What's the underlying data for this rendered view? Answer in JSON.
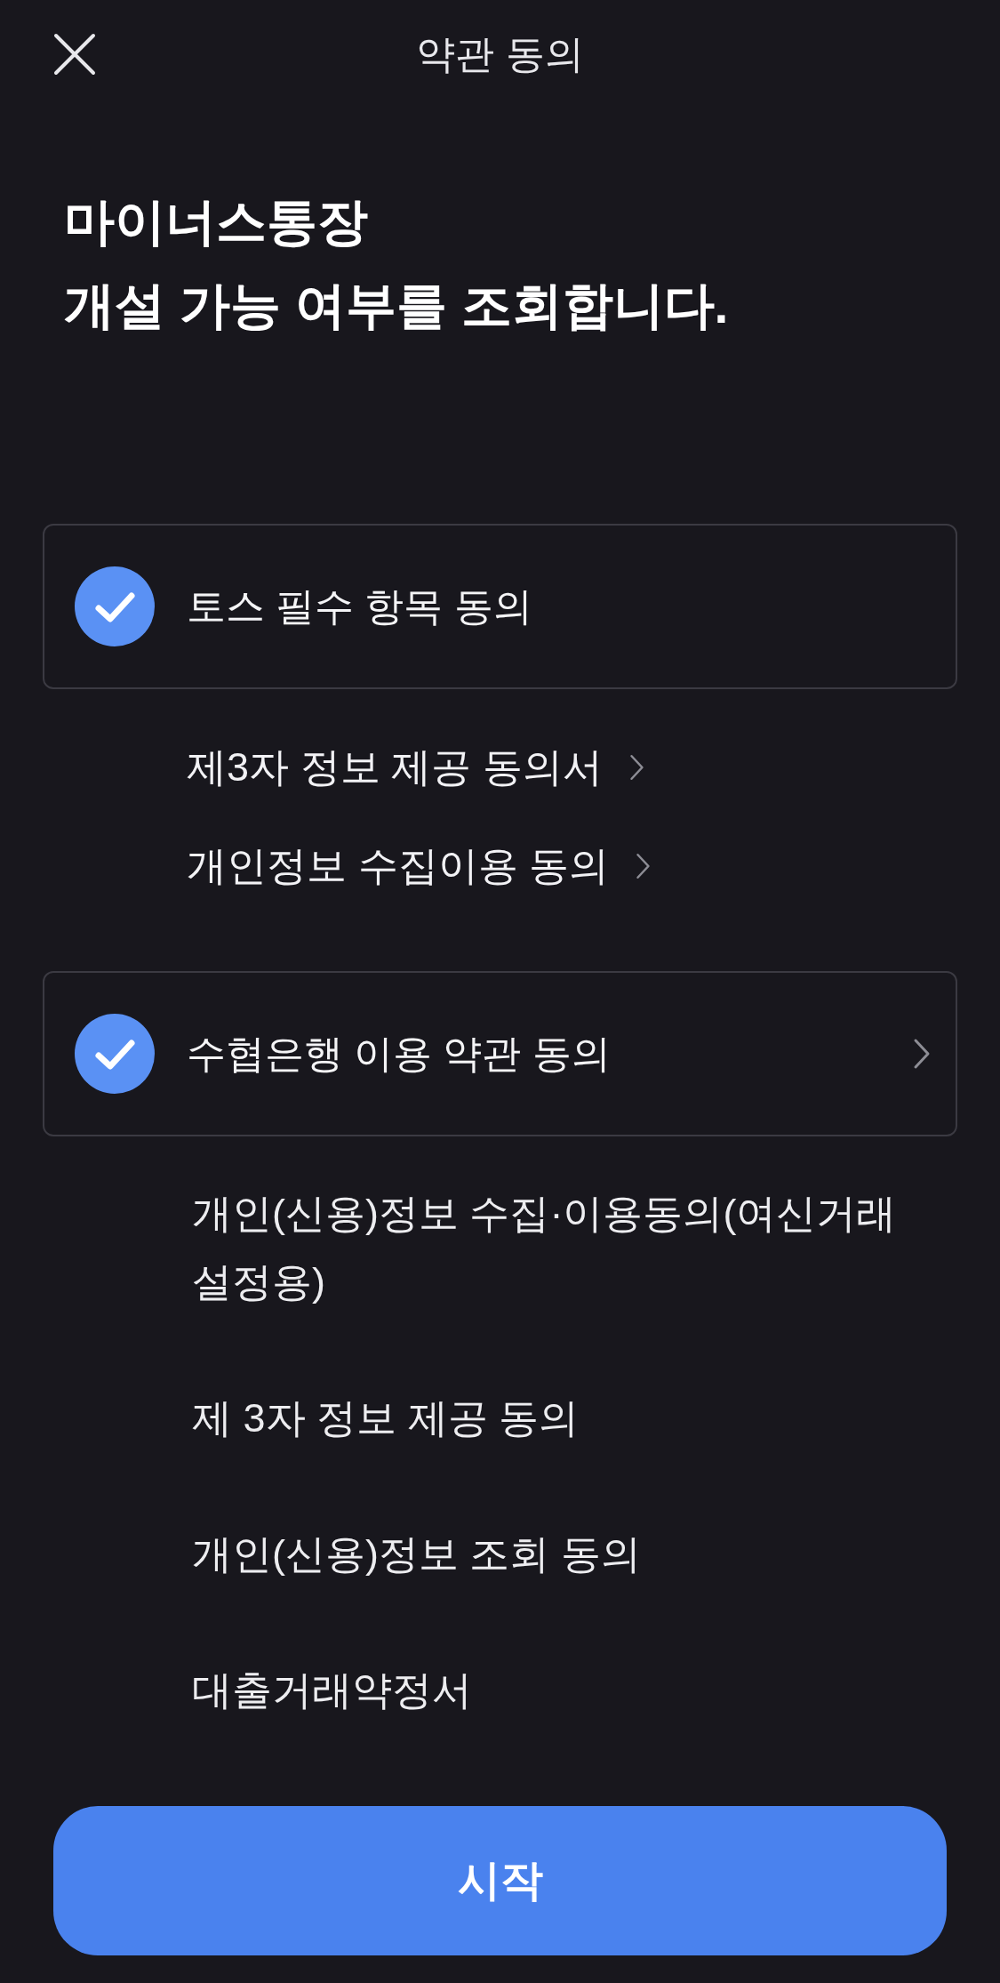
{
  "header": {
    "title": "약관 동의"
  },
  "heading": "마이너스통장\n개설 가능 여부를 조회합니다.",
  "agreements": [
    {
      "kind": "links",
      "label": "토스 필수 항목 동의",
      "checked": true,
      "chevron": false,
      "documents": [
        {
          "label": "제3자 정보 제공 동의서",
          "chevron": true
        },
        {
          "label": "개인정보 수집이용 동의",
          "chevron": true
        }
      ]
    },
    {
      "kind": "list",
      "label": "수협은행 이용 약관 동의",
      "checked": true,
      "chevron": true,
      "documents": [
        {
          "label": "개인(신용)정보 수집·이용동의(여신거래 설정용)",
          "chevron": false
        },
        {
          "label": "제 3자 정보 제공 동의",
          "chevron": false
        },
        {
          "label": "개인(신용)정보 조회 동의",
          "chevron": false
        },
        {
          "label": "대출거래약정서",
          "chevron": false
        }
      ]
    }
  ],
  "start_button": {
    "label": "시작"
  }
}
